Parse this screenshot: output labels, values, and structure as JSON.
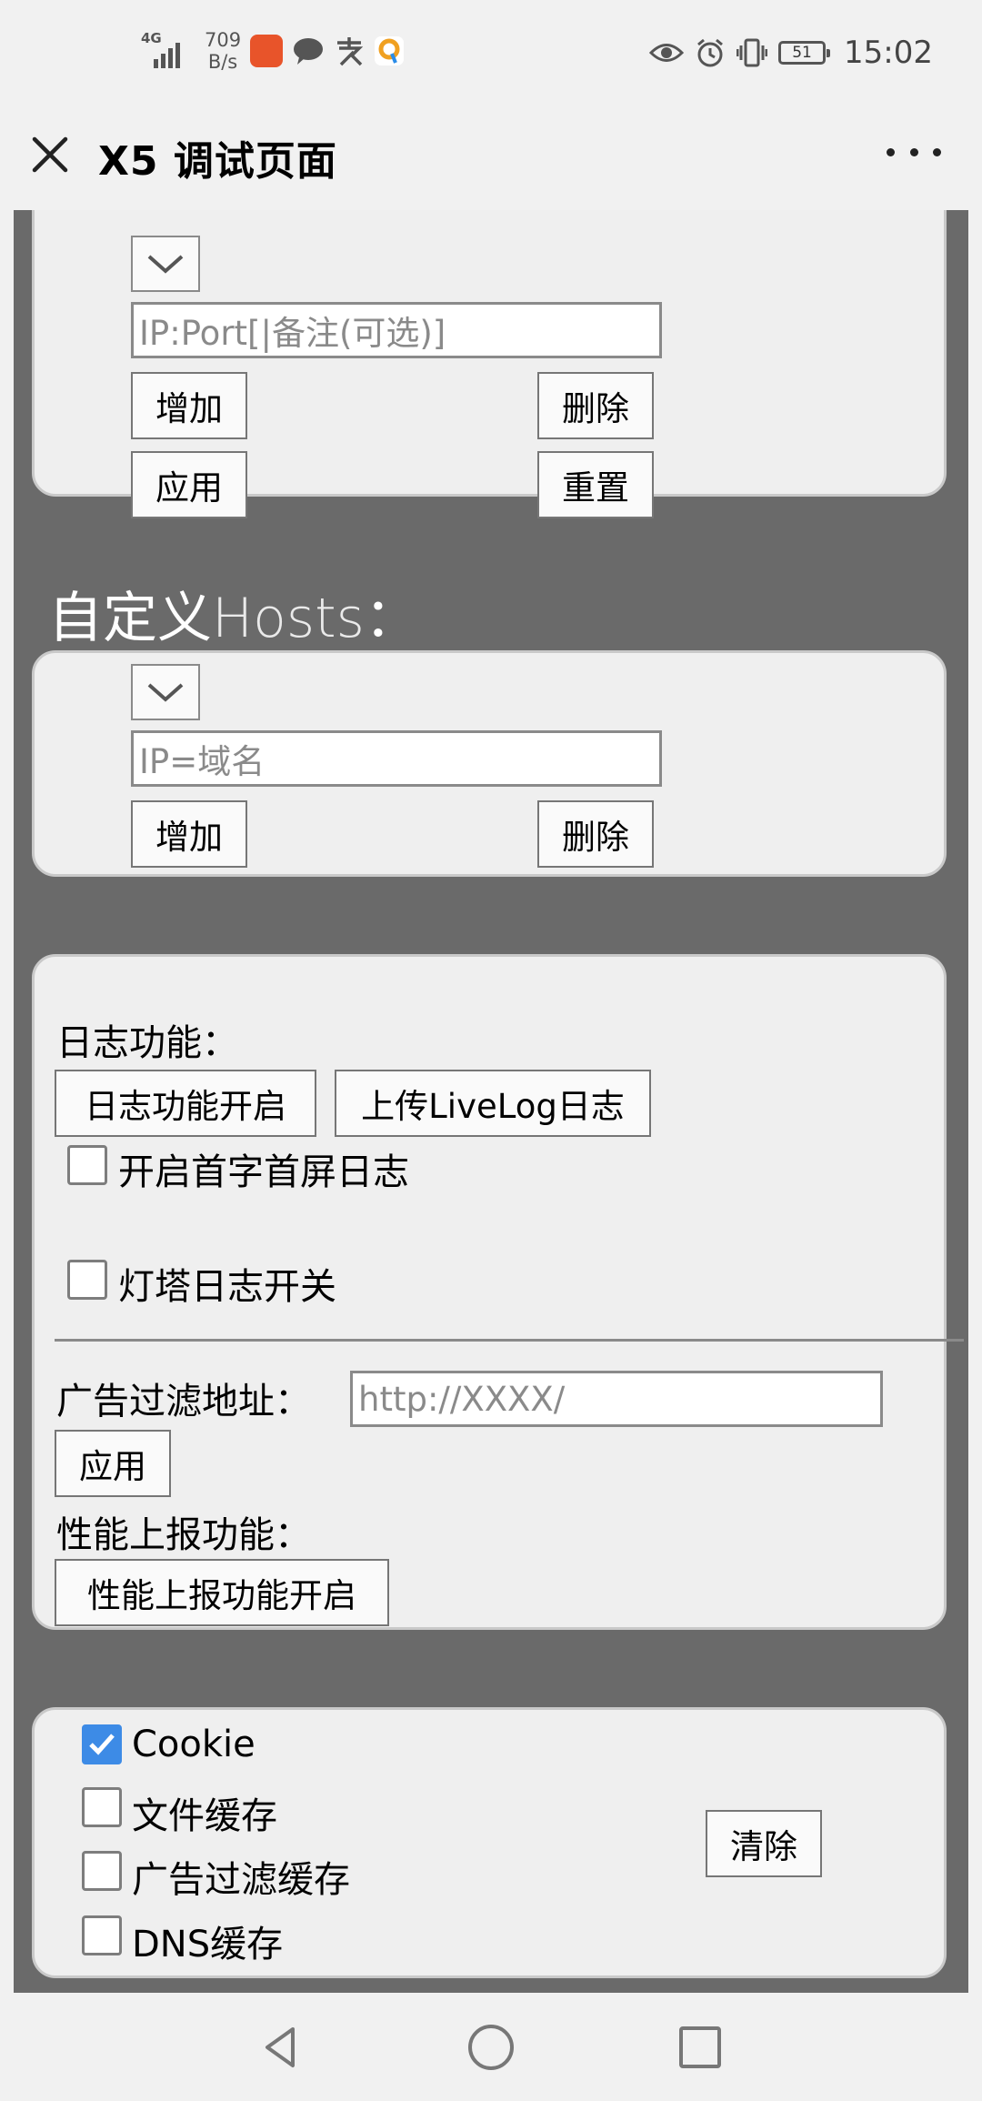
{
  "status_bar": {
    "network": "4G",
    "speed_value": "709",
    "speed_unit": "B/s",
    "time": "15:02",
    "battery": "51"
  },
  "title_bar": {
    "title": "X5 调试页面"
  },
  "proxy_panel": {
    "input_placeholder": "IP:Port[|备注(可选)]",
    "add_label": "增加",
    "delete_label": "删除",
    "apply_label": "应用",
    "reset_label": "重置"
  },
  "hosts_section": {
    "title_cn": "自定义",
    "title_en": "Hosts",
    "title_colon": "：",
    "input_placeholder": "IP=域名",
    "add_label": "增加",
    "delete_label": "删除"
  },
  "log_panel": {
    "log_label": "日志功能：",
    "log_enable_label": "日志功能开启",
    "upload_livelog_label": "上传LiveLog日志",
    "first_screen_log_label": "开启首字首屏日志",
    "first_screen_log_checked": false,
    "beacon_log_label": "灯塔日志开关",
    "beacon_log_checked": false,
    "ad_filter_label": "广告过滤地址：",
    "ad_filter_placeholder": "http://XXXX/",
    "apply_label": "应用",
    "perf_label": "性能上报功能：",
    "perf_enable_label": "性能上报功能开启"
  },
  "cache_panel": {
    "items": [
      {
        "label": "Cookie",
        "checked": true
      },
      {
        "label": "文件缓存",
        "checked": false
      },
      {
        "label": "广告过滤缓存",
        "checked": false
      },
      {
        "label": "DNS缓存",
        "checked": false
      }
    ],
    "clear_label": "清除"
  },
  "colors": {
    "checkbox_accent": "#3d8be6",
    "content_background": "#6a6a6a"
  },
  "icons": {
    "close": "close-icon",
    "more": "more-icon",
    "back": "back-triangle-icon",
    "home": "home-circle-icon",
    "recents": "recents-square-icon"
  }
}
